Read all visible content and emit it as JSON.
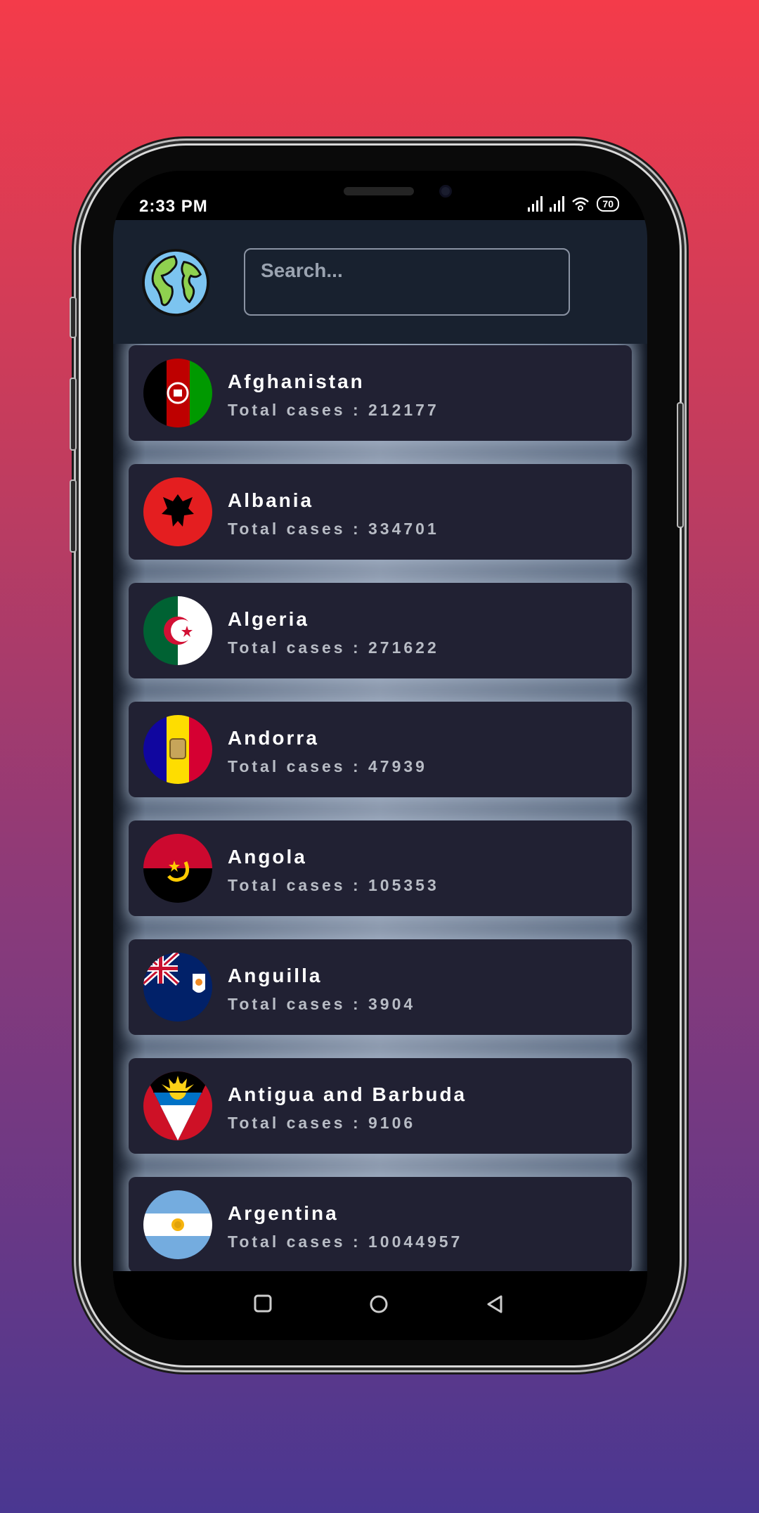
{
  "status_bar": {
    "time": "2:33 PM",
    "battery": "70"
  },
  "header": {
    "logo_icon": "globe-icon",
    "search_placeholder": "Search..."
  },
  "countries": [
    {
      "name": "Afghanistan",
      "cases_text": "Total cases : 212177",
      "flag_icon": "afghanistan-flag-icon"
    },
    {
      "name": "Albania",
      "cases_text": "Total cases : 334701",
      "flag_icon": "albania-flag-icon"
    },
    {
      "name": "Algeria",
      "cases_text": "Total cases : 271622",
      "flag_icon": "algeria-flag-icon"
    },
    {
      "name": "Andorra",
      "cases_text": "Total cases : 47939",
      "flag_icon": "andorra-flag-icon"
    },
    {
      "name": "Angola",
      "cases_text": "Total cases : 105353",
      "flag_icon": "angola-flag-icon"
    },
    {
      "name": "Anguilla",
      "cases_text": "Total cases : 3904",
      "flag_icon": "anguilla-flag-icon"
    },
    {
      "name": "Antigua and Barbuda",
      "cases_text": "Total cases : 9106",
      "flag_icon": "antigua-flag-icon"
    },
    {
      "name": "Argentina",
      "cases_text": "Total cases : 10044957",
      "flag_icon": "argentina-flag-icon"
    }
  ],
  "nav": {
    "recents_icon": "square-recents-icon",
    "home_icon": "circle-home-icon",
    "back_icon": "triangle-back-icon"
  },
  "colors": {
    "background_top": "#f43b4a",
    "background_bottom": "#4a3791",
    "header_bg": "#18212f",
    "card_bg": "#212133"
  }
}
